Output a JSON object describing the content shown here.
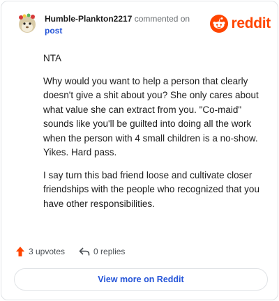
{
  "header": {
    "author": "Humble-Plankton2217",
    "action": "commented on",
    "post_link": "post",
    "brand": "reddit",
    "avatar_icon": "snoo-avatar-icon",
    "brand_icon": "reddit-logo-icon"
  },
  "comment": {
    "paragraphs": [
      "NTA",
      "Why would you want to help a person that clearly doesn't give a shit about you? She only cares about what value she can extract from you. \"Co-maid\" sounds like you'll be guilted into doing all the work when the person with 4 small children is a no-show. Yikes. Hard pass.",
      "I say turn this bad friend loose and cultivate closer friendships with the people who recognized that you have other responsibilities."
    ]
  },
  "footer": {
    "upvotes": "3 upvotes",
    "replies": "0 replies",
    "upvote_icon": "upvote-arrow-icon",
    "reply_icon": "reply-arrow-icon"
  },
  "cta": {
    "label": "View more on Reddit"
  },
  "colors": {
    "brand": "#ff4500",
    "link": "#2454d8",
    "upvote": "#ff4500",
    "border": "#e0e3e6"
  }
}
